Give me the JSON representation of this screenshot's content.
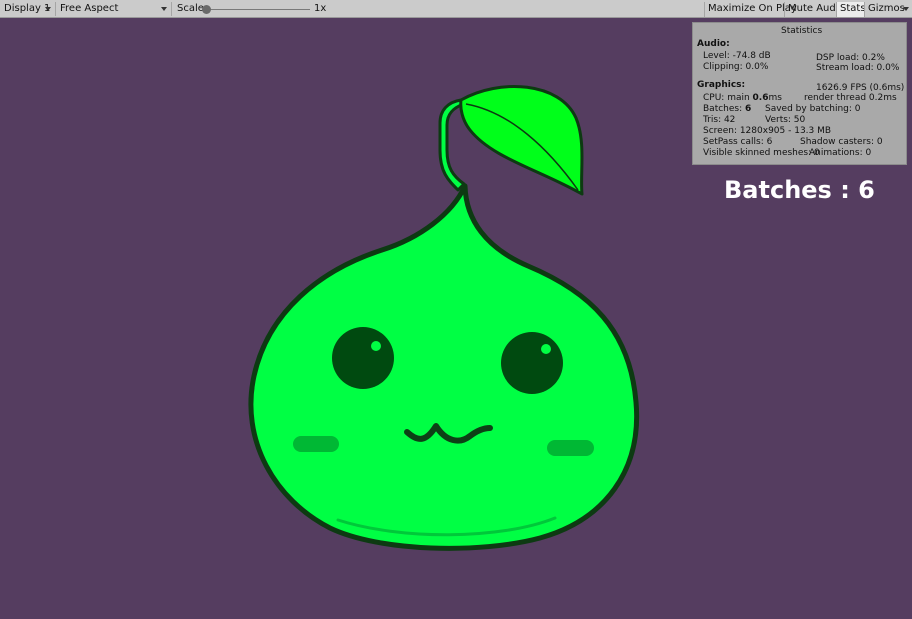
{
  "toolbar": {
    "display": "Display 1",
    "aspect": "Free Aspect",
    "scale_label": "Scale",
    "scale_value": "1x",
    "scale_level": 0,
    "maximize": "Maximize On Play",
    "mute": "Mute Audio",
    "stats": "Stats",
    "gizmos": "Gizmos"
  },
  "stats": {
    "title": "Statistics",
    "audio_header": "Audio:",
    "level": "Level: -74.8 dB",
    "clipping": "Clipping: 0.0%",
    "dsp": "DSP load: 0.2%",
    "stream": "Stream load: 0.0%",
    "graphics_header": "Graphics:",
    "fps": "1626.9 FPS (0.6ms)",
    "cpu_prefix": "CPU: main ",
    "cpu_value": "0.6",
    "cpu_suffix": "ms",
    "render_thread": "render thread 0.2ms",
    "batches_prefix": "Batches: ",
    "batches_value": "6",
    "saved_batching": "Saved by batching: 0",
    "tris": "Tris: 42",
    "verts": "Verts: 50",
    "screen": "Screen: 1280x905 - 13.3 MB",
    "setpass": "SetPass calls: 6",
    "shadow_casters": "Shadow casters: 0",
    "skinned": "Visible skinned meshes: 0",
    "animations": "Animations: 0"
  },
  "overlay": {
    "batches_text": "Batches : 6"
  },
  "colors": {
    "background": "#553d60",
    "slime": "#00ff44",
    "outline": "#0d3a12",
    "eyes": "#004a10",
    "cheeks": "#00b834"
  }
}
